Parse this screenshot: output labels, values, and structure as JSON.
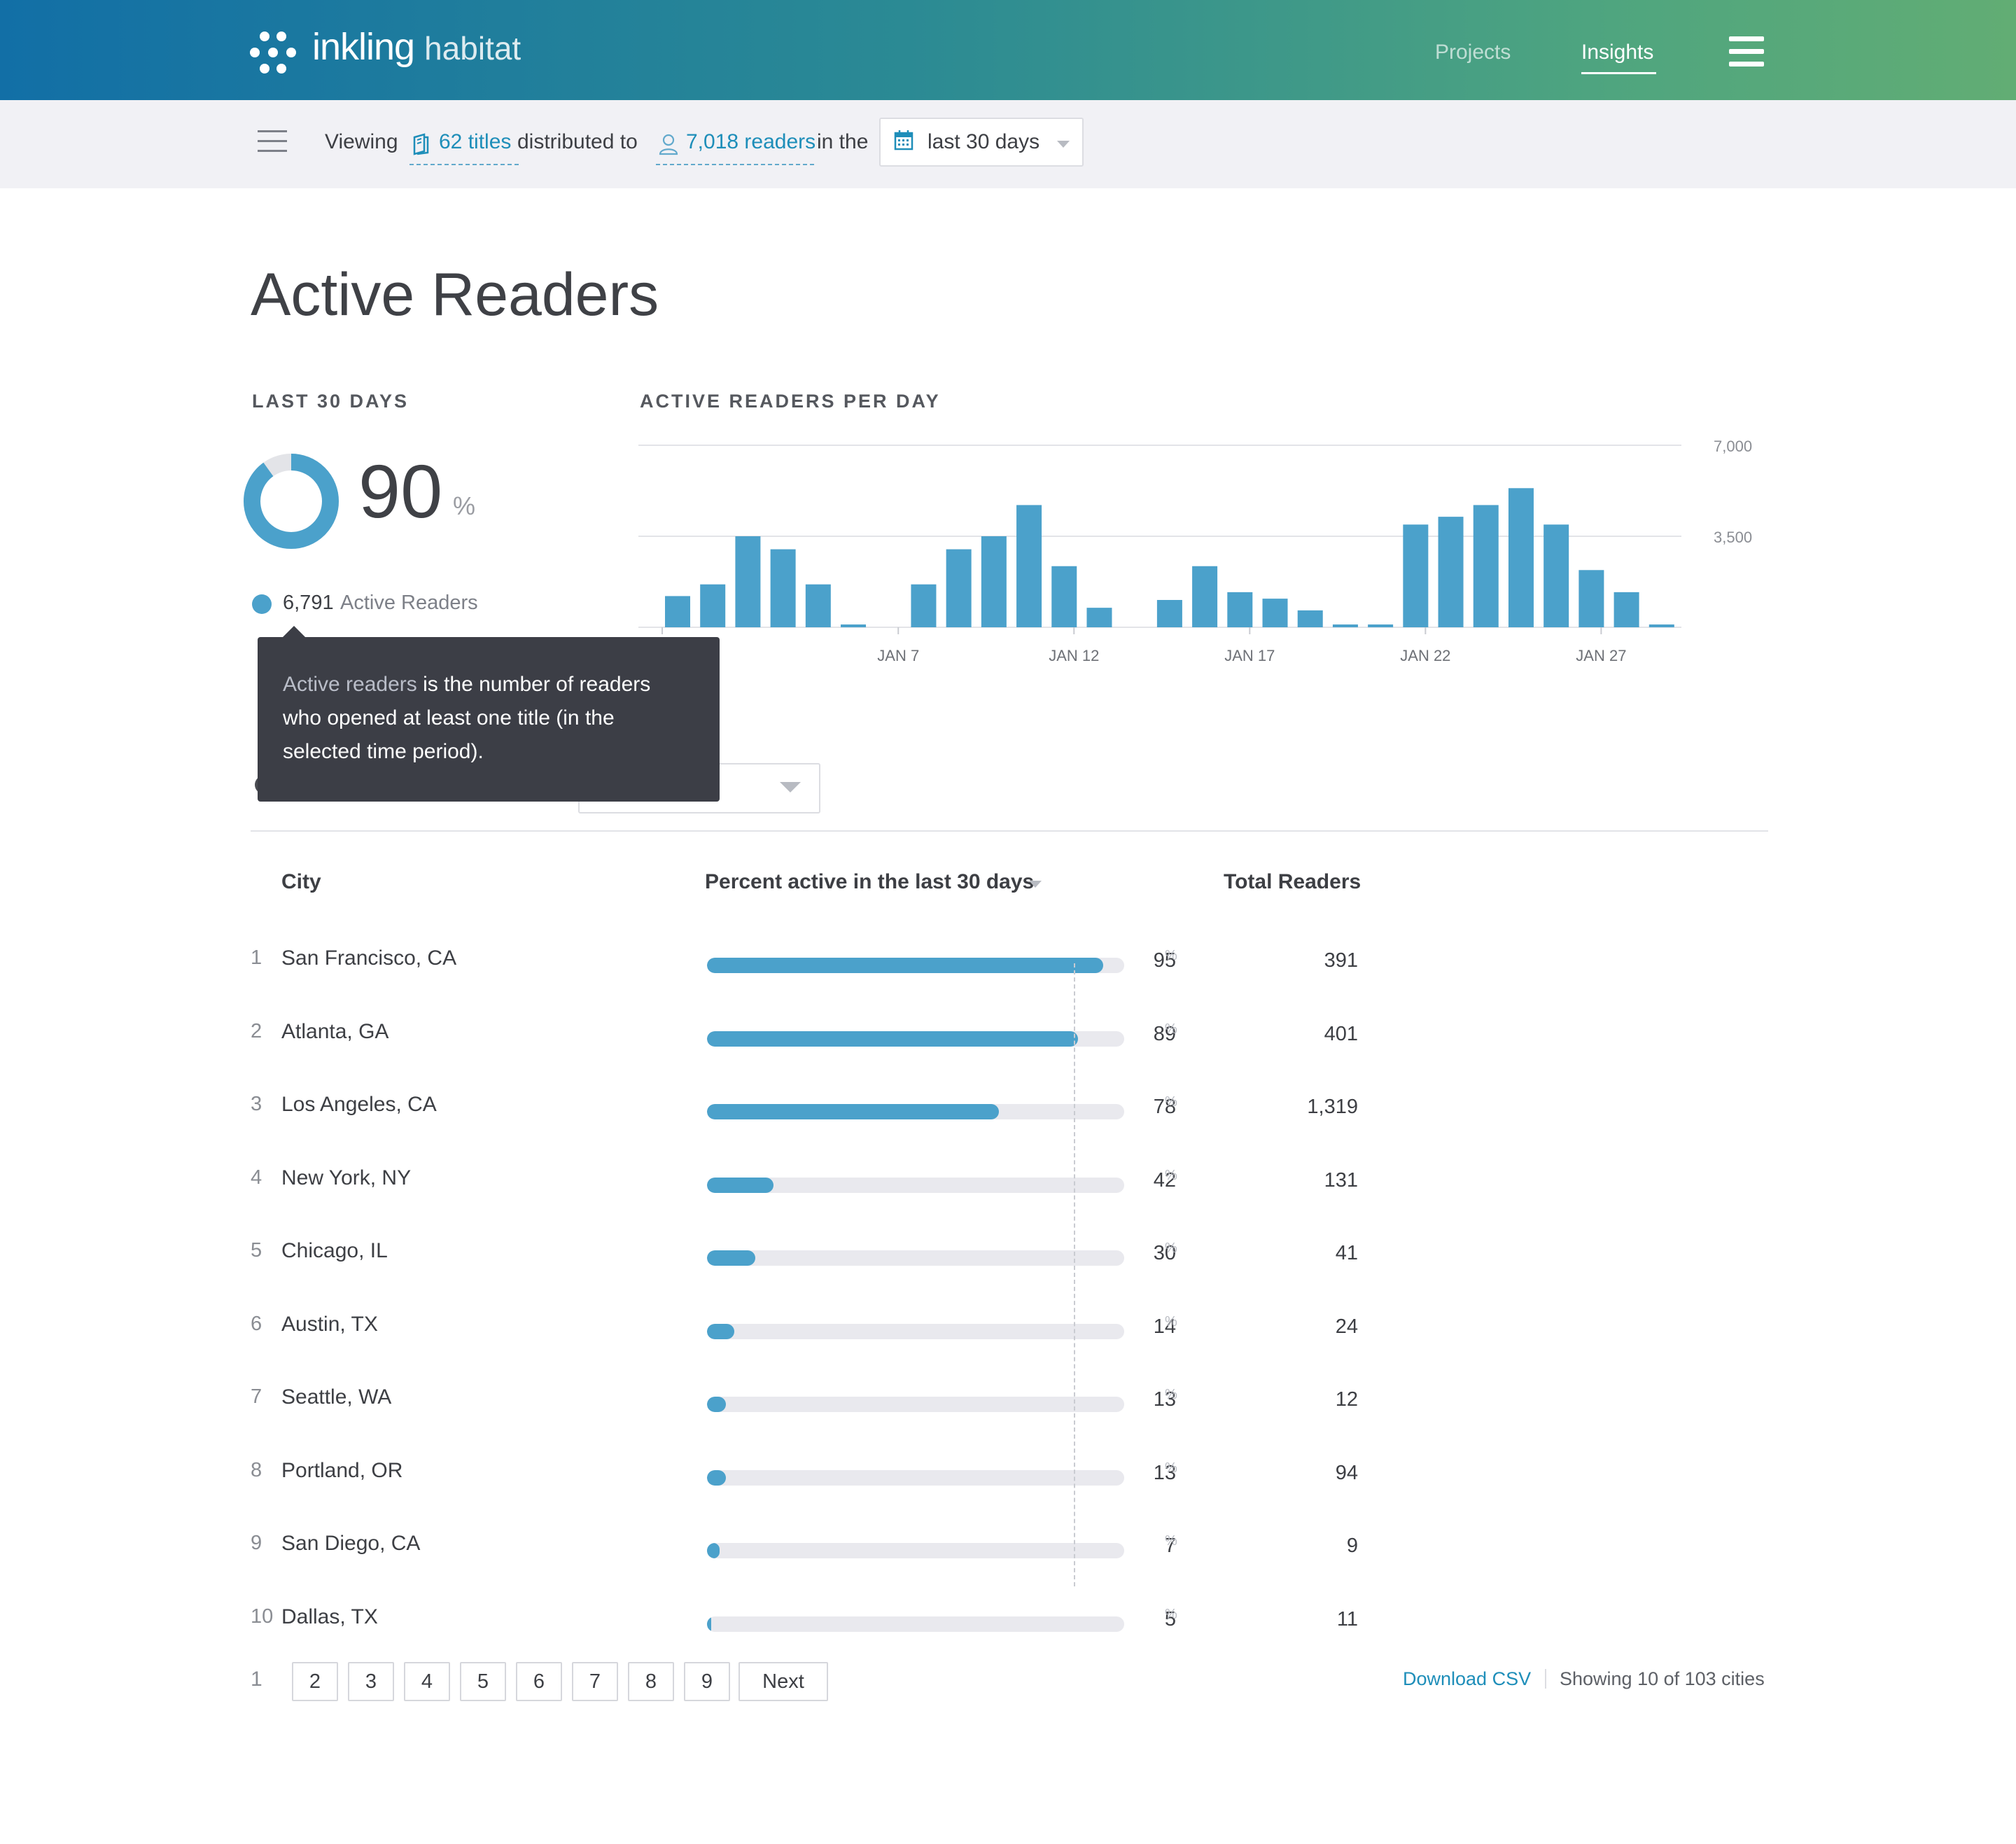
{
  "header": {
    "brand_primary": "inkling",
    "brand_secondary": "habitat",
    "nav": [
      {
        "label": "Projects",
        "active": false
      },
      {
        "label": "Insights",
        "active": true
      }
    ]
  },
  "subbar": {
    "viewing": "Viewing",
    "titles_link": "62 titles",
    "distributed_to": "distributed to",
    "readers_link": "7,018 readers",
    "in_the": "in the",
    "date_range": "last 30 days"
  },
  "page": {
    "title": "Active Readers",
    "summary_label": "LAST 30 DAYS",
    "chart_label": "ACTIVE READERS PER DAY",
    "active_percent": "90",
    "percent_sign": "%",
    "active_percent_value": 90,
    "legend_count": "6,791",
    "legend_label": "Active Readers"
  },
  "tooltip": {
    "highlight": "Active readers",
    "text": " is the number of readers who opened at least one title (in the selected time period)."
  },
  "colors": {
    "accent": "#4ba1cb",
    "link": "#1e8eb9",
    "tooltip_bg": "#3c3e46",
    "header_start": "#126fa6",
    "header_end": "#62ad74"
  },
  "chart_data": {
    "type": "bar",
    "title": "ACTIVE READERS PER DAY",
    "ylim": [
      0,
      7000
    ],
    "y_ticks": [
      "7,000",
      "3,500"
    ],
    "y_tick_values": [
      7000,
      3500
    ],
    "x_tick_labels": [
      "JAN 7",
      "JAN 12",
      "JAN 17",
      "JAN 22",
      "JAN 27"
    ],
    "x_tick_days": [
      7,
      12,
      17,
      22,
      27
    ],
    "grid": true,
    "days": [
      1,
      2,
      3,
      4,
      5,
      6,
      7,
      8,
      9,
      10,
      11,
      12,
      13,
      14,
      15,
      16,
      17,
      18,
      19,
      20,
      21,
      22,
      23,
      24,
      25,
      26,
      27,
      28
    ],
    "values": [
      1200,
      1650,
      3500,
      3000,
      1650,
      100,
      0,
      1650,
      3000,
      3500,
      4700,
      2350,
      750,
      0,
      1050,
      2350,
      1350,
      1100,
      650,
      100,
      100,
      3950,
      4250,
      4700,
      5350,
      3950,
      2200,
      1350,
      100
    ]
  },
  "table": {
    "headers": {
      "city": "City",
      "percent": "Percent active in the last 30 days",
      "total": "Total Readers"
    },
    "reference_percent": 88,
    "rows": [
      {
        "rank": "1",
        "city": "San Francisco, CA",
        "percent": "95",
        "percent_value": 95,
        "total": "391"
      },
      {
        "rank": "2",
        "city": "Atlanta, GA",
        "percent": "89",
        "percent_value": 89,
        "total": "401"
      },
      {
        "rank": "3",
        "city": "Los Angeles, CA",
        "percent": "78",
        "percent_value": 70,
        "total": "1,319"
      },
      {
        "rank": "4",
        "city": "New York, NY",
        "percent": "42",
        "percent_value": 16,
        "total": "131"
      },
      {
        "rank": "5",
        "city": "Chicago, IL",
        "percent": "30",
        "percent_value": 11.5,
        "total": "41"
      },
      {
        "rank": "6",
        "city": "Austin, TX",
        "percent": "14",
        "percent_value": 6.5,
        "total": "24"
      },
      {
        "rank": "7",
        "city": "Seattle, WA",
        "percent": "13",
        "percent_value": 4.5,
        "total": "12"
      },
      {
        "rank": "8",
        "city": "Portland, OR",
        "percent": "13",
        "percent_value": 4.5,
        "total": "94"
      },
      {
        "rank": "9",
        "city": "San Diego, CA",
        "percent": "7",
        "percent_value": 3,
        "total": "9"
      },
      {
        "rank": "10",
        "city": "Dallas, TX",
        "percent": "5",
        "percent_value": 1,
        "total": "11"
      }
    ]
  },
  "pagination": {
    "current": "1",
    "pages": [
      "2",
      "3",
      "4",
      "5",
      "6",
      "7",
      "8",
      "9"
    ],
    "next": "Next"
  },
  "footer": {
    "download": "Download CSV",
    "showing": "Showing 10 of 103 cities"
  }
}
